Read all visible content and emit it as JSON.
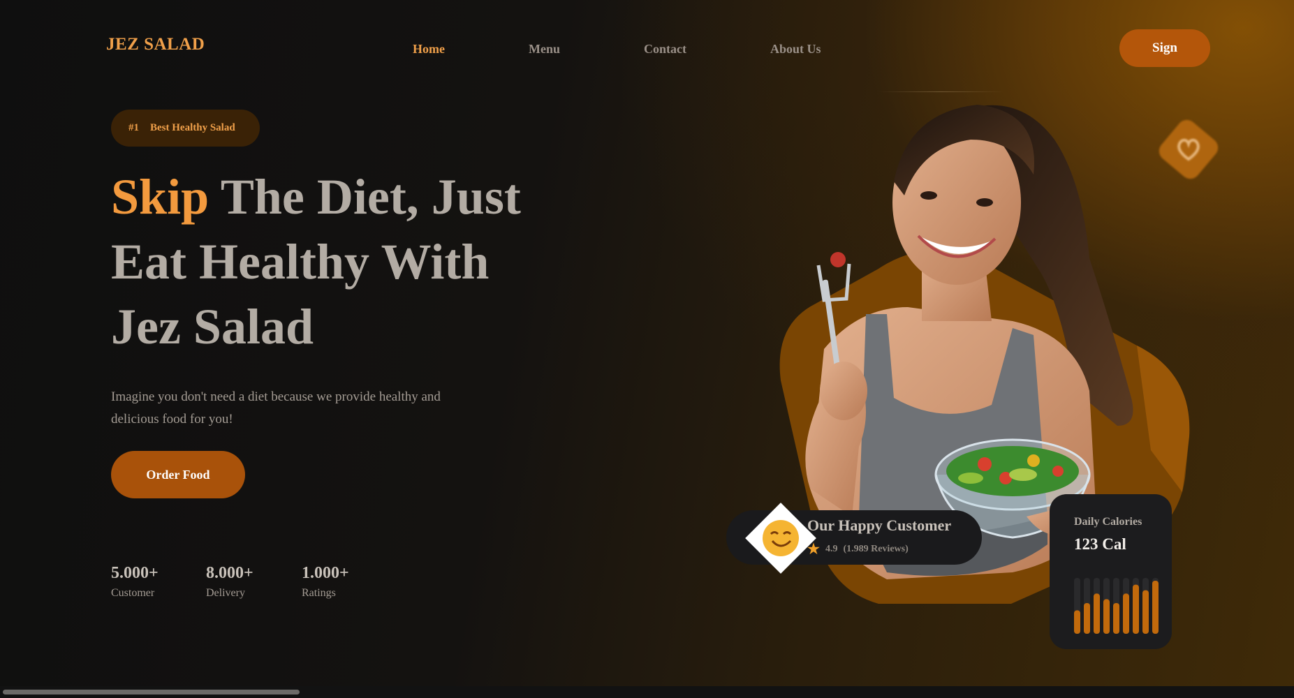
{
  "brand": {
    "logo": "JEZ SALAD",
    "accent_color": "#f0a04a",
    "button_color": "#b4560a"
  },
  "nav": {
    "items": [
      {
        "label": "Home",
        "active": true
      },
      {
        "label": "Menu",
        "active": false
      },
      {
        "label": "Contact",
        "active": false
      },
      {
        "label": "About Us",
        "active": false
      }
    ],
    "sign_label": "Sign"
  },
  "hero": {
    "badge_number": "#1",
    "badge_text": "Best Healthy Salad",
    "headline_accent": "Skip",
    "headline_line1_rest": " The Diet, Just",
    "headline_line2": "Eat Healthy With",
    "headline_line3": "Jez Salad",
    "description": "Imagine you don't need a diet because we provide healthy and delicious food for you!",
    "order_button": "Order Food"
  },
  "stats": [
    {
      "value": "5.000+",
      "label": "Customer"
    },
    {
      "value": "8.000+",
      "label": "Delivery"
    },
    {
      "value": "1.000+",
      "label": "Ratings"
    }
  ],
  "happy_customer": {
    "title": "Our Happy Customer",
    "rating": "4.9",
    "reviews": "(1.989 Reviews)",
    "icons": [
      "smiling-emoji-icon",
      "star-icon"
    ]
  },
  "calories": {
    "label": "Daily Calories",
    "value": "123 Cal",
    "bar_levels": [
      0.42,
      0.55,
      0.72,
      0.62,
      0.55,
      0.72,
      0.88,
      0.78,
      0.95
    ]
  },
  "decor_icons": [
    "heart-icon"
  ]
}
